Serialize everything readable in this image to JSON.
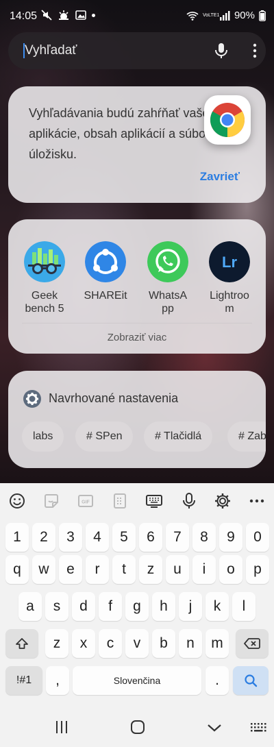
{
  "status": {
    "time": "14:05",
    "battery": "90%",
    "network": "VoLTE1"
  },
  "search": {
    "value": "Vyhľadať"
  },
  "notice": {
    "lines": [
      "Vyhľadávania budú zahŕňať vaše",
      "aplikácie, obsah aplikácií a súbory v",
      "úložisku."
    ],
    "close_label": "Zavrieť"
  },
  "apps": {
    "items": [
      {
        "name": "Geek bench 5",
        "label1": "Geek",
        "label2": "bench 5"
      },
      {
        "name": "SHAREit",
        "label1": "SHAREit",
        "label2": ""
      },
      {
        "name": "WhatsApp",
        "label1": "WhatsA",
        "label2": "pp"
      },
      {
        "name": "Lightroom",
        "label1": "Lightroo",
        "label2": "m"
      }
    ],
    "more_label": "Zobraziť viac"
  },
  "suggest": {
    "title": "Navrhované nastavenia",
    "chips": [
      "labs",
      "# SPen",
      "# Tlačidlá",
      "# Zab"
    ]
  },
  "keyboard": {
    "row_numbers": [
      "1",
      "2",
      "3",
      "4",
      "5",
      "6",
      "7",
      "8",
      "9",
      "0"
    ],
    "row1": [
      "q",
      "w",
      "e",
      "r",
      "t",
      "z",
      "u",
      "i",
      "o",
      "p"
    ],
    "row2": [
      "a",
      "s",
      "d",
      "f",
      "g",
      "h",
      "j",
      "k",
      "l"
    ],
    "row3": [
      "z",
      "x",
      "c",
      "v",
      "b",
      "n",
      "m"
    ],
    "sym_label": "!#1",
    "comma": ",",
    "space_label": "Slovenčina",
    "period": "."
  },
  "colors": {
    "accent": "#2b7de1"
  }
}
